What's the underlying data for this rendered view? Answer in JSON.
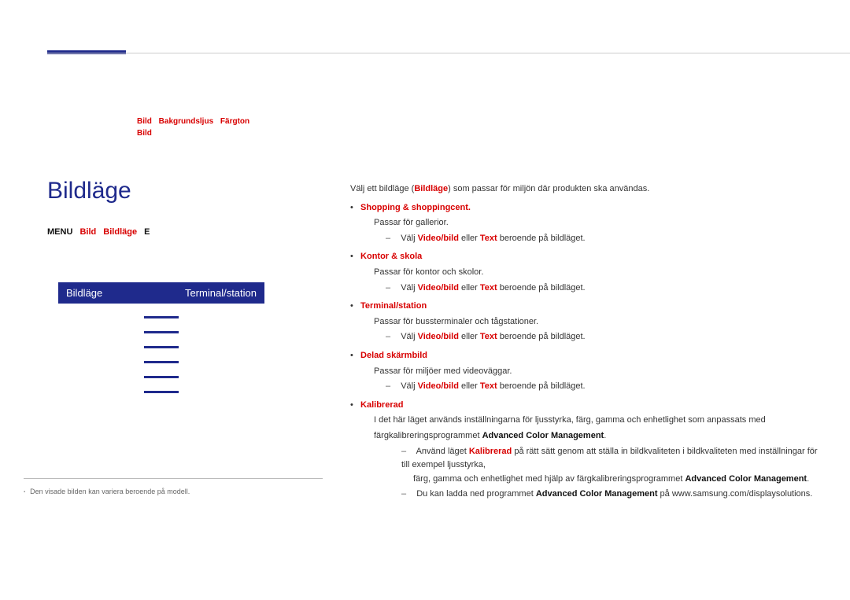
{
  "head_tags": {
    "line1": [
      "Bild",
      "Bakgrundsljus",
      "Färgton"
    ],
    "line2": [
      "Bild"
    ]
  },
  "title": "Bildläge",
  "breadcrumb": {
    "b1": "MENU",
    "b2": "Bild",
    "b3": "Bildläge",
    "b4": "E"
  },
  "panel": {
    "left": "Bildläge",
    "right": "Terminal/station"
  },
  "intro": {
    "t1": "Välj ett bildläge (",
    "t2": "Bildläge",
    "t3": ") som passar för miljön där produkten ska användas."
  },
  "modes": {
    "dot": "•",
    "shopping": {
      "label_prefix": "Shopping & shoppingcent.",
      "desc": "Passar för gallerior.",
      "choose": "Välj",
      "a": "Video/bild",
      "mid": "eller",
      "b": "Text",
      "tail": "beroende på bildläget."
    },
    "office": {
      "label_prefix": "Kontor & skola",
      "desc": "Passar för kontor och skolor.",
      "a": "Video/bild",
      "b": "Text"
    },
    "terminal": {
      "label_prefix": "Terminal/station",
      "desc": "Passar för bussterminaler och tågstationer.",
      "a": "Video/bild",
      "b": "Text"
    },
    "videowall": {
      "label_prefix": "Delad skärmbild",
      "desc": "Passar för miljöer med videoväggar.",
      "a": "Video/bild",
      "b": "Text"
    },
    "calibrated": {
      "label_prefix": "Kalibrerad",
      "p1a": "I det här läget används inställningarna för ljusstyrka, färg, gamma och enhetlighet som anpassats med",
      "p1b1": "färgkalibreringsprogrammet ",
      "p1b2": "Advanced Color Management",
      "p1b3": ".",
      "b1a": "Använd läget ",
      "b1b": "Kalibrerad",
      "b1c": " på rätt sätt genom att ställa in bildkvaliteten i bildkvaliteten med inställningar för till exempel ljusstyrka,",
      "b1d": "färg, gamma och enhetlighet med hjälp av färgkalibreringsprogrammet ",
      "b1e": "Advanced Color Management",
      "b1f": ".",
      "b2a": "Du kan ladda ned programmet ",
      "b2b": "Advanced Color Management",
      "b2c": " på www.samsung.com/displaysolutions."
    }
  },
  "footer": "Den visade bilden kan variera beroende på modell."
}
